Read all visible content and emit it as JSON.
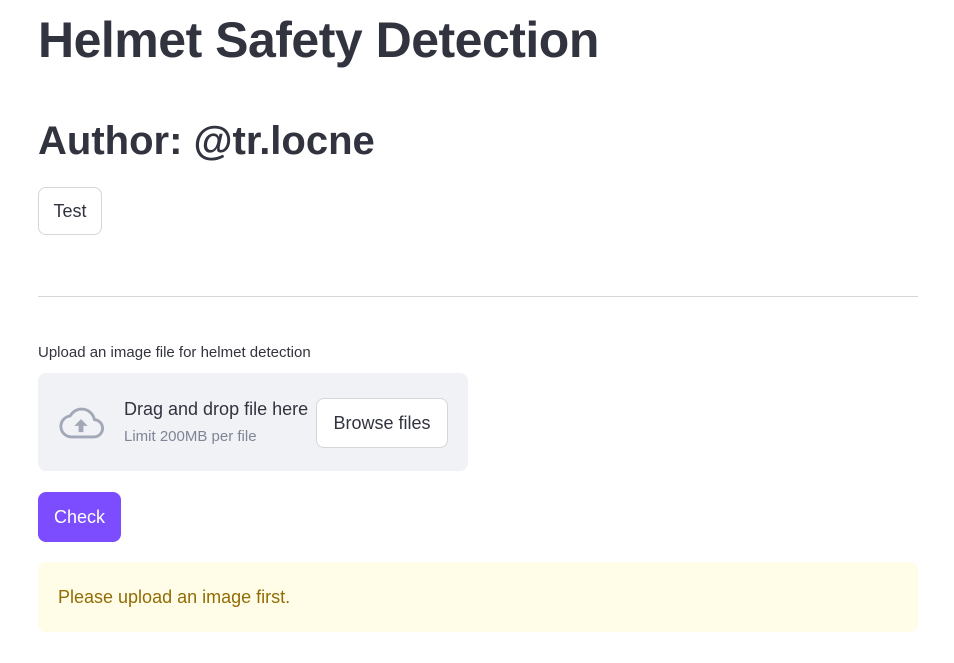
{
  "header": {
    "title": "Helmet Safety Detection",
    "author": "Author: @tr.locne"
  },
  "test_button": {
    "label": "Test"
  },
  "uploader": {
    "label": "Upload an image file for helmet detection",
    "drag_text": "Drag and drop file here",
    "limit_text": "Limit 200MB per file",
    "browse_label": "Browse files",
    "icon": "cloud-upload-icon"
  },
  "check_button": {
    "label": "Check"
  },
  "alert": {
    "message": "Please upload an image first."
  },
  "colors": {
    "primary": "#7c4dff",
    "text": "#31333f",
    "muted": "#808495",
    "dropzone_bg": "#f0f2f6",
    "warning_bg": "#fffce7",
    "warning_text": "#926c05",
    "icon": "#a3a8b8"
  }
}
